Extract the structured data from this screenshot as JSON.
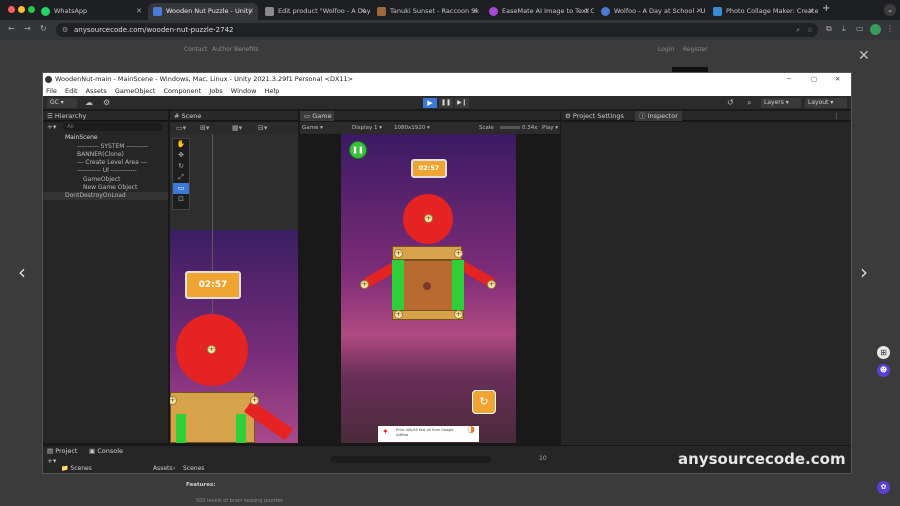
{
  "browser": {
    "tabs": [
      {
        "label": "WhatsApp",
        "color": "#25d366"
      },
      {
        "label": "Wooden Nut Puzzle - Unity",
        "color": "#4b7bd6"
      },
      {
        "label": "Edit product \"Wolfoo - A Day",
        "color": "#8a8a8a"
      },
      {
        "label": "Tanuki Sunset - Raccoon Sk",
        "color": "#9b6a3a"
      },
      {
        "label": "EaseMate AI Image to Text C",
        "color": "#a04ad6"
      },
      {
        "label": "Wolfoo - A Day at School - U",
        "color": "#4b7bd6"
      },
      {
        "label": "Photo Collage Maker: Create",
        "color": "#3a8ad6"
      }
    ],
    "url": "anysourcecode.com/wooden-nut-puzzle-2742"
  },
  "site": {
    "links": [
      "Contact",
      "Author Benefits"
    ],
    "right_links": [
      "Login",
      "Register"
    ],
    "features_heading": "Features:",
    "features_item": "500 levels of brain teasing puzzles",
    "watermark": "anysourcecode.com"
  },
  "unity": {
    "title": "WoodenNut-main - MainScene - Windows, Mac, Linux - Unity 2021.3.29f1 Personal <DX11>",
    "menu": [
      "File",
      "Edit",
      "Assets",
      "GameObject",
      "Component",
      "Jobs",
      "Window",
      "Help"
    ],
    "toolbar": {
      "account": "GC",
      "layers": "Layers",
      "layout": "Layout"
    },
    "hierarchy": {
      "tab": "Hierarchy",
      "search_placeholder": "All",
      "rows": [
        "MainScene",
        "---------- SYSTEM ----------",
        "BANNER(Clone)",
        "--- Create Level Area ---",
        "----------- UI ------------",
        "GameObject",
        "New Game Object",
        "DontDestroyOnLoad"
      ]
    },
    "scene": {
      "tab": "Scene",
      "timer": "02:57"
    },
    "game": {
      "tab": "Game",
      "mode": "Game",
      "display": "Display 1",
      "resolution": "1080x1920",
      "scale_label": "Scale",
      "scale_value": "0.34x",
      "play_label": "Play",
      "timer": "02:57",
      "ad_text": "Price 40b/40 fast all from Google AdMob"
    },
    "project_settings": "Project Settings",
    "inspector": "Inspector",
    "bottom": {
      "project_tab": "Project",
      "console_tab": "Console",
      "folder": "Scenes",
      "breadcrumb_root": "Assets",
      "breadcrumb_leaf": "Scenes",
      "count": "10"
    }
  },
  "colors": {
    "accent": "#3a79d8",
    "red": "#e52323",
    "green": "#2fcf3a",
    "wood": "#d6a24a"
  }
}
